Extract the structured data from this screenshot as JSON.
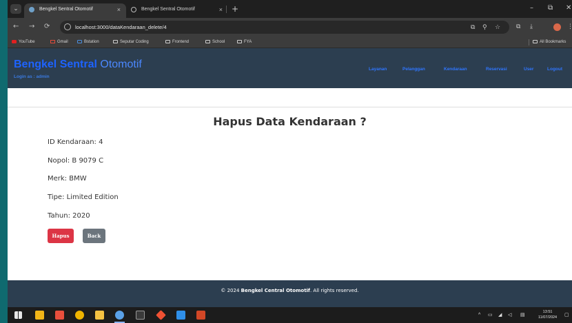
{
  "browser": {
    "tabs": [
      {
        "label": "Bengkel Sentral Otomotif",
        "active": true,
        "close_icon": "×"
      },
      {
        "label": "Bengkel Sentral Otomotif",
        "active": false,
        "close_icon": "×"
      }
    ],
    "new_tab_icon": "+",
    "tab_menu_icon": "⌄",
    "window_controls": {
      "minimize": "–",
      "maximize": "⧉",
      "close": "✕"
    },
    "nav": {
      "back": "←",
      "forward": "→",
      "reload": "⟳"
    },
    "url": "localhost:3000/dataKendaraan_delete/4",
    "omnibox_icons": {
      "install": "⧉",
      "zoom": "⚲",
      "star": "☆"
    },
    "toolbar_icons": {
      "extensions": "⧉",
      "downloads": "⤓",
      "menu": "⋮"
    },
    "bookmarks": [
      {
        "label": "YouTube",
        "icon": "youtube-icon"
      },
      {
        "label": "Gmail",
        "icon": "gmail-icon"
      },
      {
        "label": "Bstation",
        "icon": "bstation-icon"
      },
      {
        "label": "Seputar Coding",
        "icon": "folder-icon"
      },
      {
        "label": "Frontend",
        "icon": "folder-icon"
      },
      {
        "label": "School",
        "icon": "folder-icon"
      },
      {
        "label": "FYA",
        "icon": "folder-icon"
      }
    ],
    "all_bookmarks": "All Bookmarks"
  },
  "site": {
    "brand_bold": "Bengkel Sentral",
    "brand_light": "Otomotif",
    "login_prefix": "Login as : ",
    "login_user": "admin",
    "nav": [
      "Layanan",
      "Pelanggan",
      "Kendaraan",
      "Reservasi",
      "User",
      "Logout"
    ]
  },
  "main": {
    "title": "Hapus Data Kendaraan ?",
    "fields": [
      {
        "label": "ID Kendaraan:",
        "value": "4"
      },
      {
        "label": "Nopol:",
        "value": "B 9079 C"
      },
      {
        "label": "Merk:",
        "value": "BMW"
      },
      {
        "label": "Tipe:",
        "value": "Limited Edition"
      },
      {
        "label": "Tahun:",
        "value": "2020"
      }
    ],
    "delete_button": "Hapus",
    "back_button": "Back"
  },
  "footer": {
    "prefix": "© 2024 ",
    "brand": "Bengkel Central Otomotif",
    "suffix": ". All rights reserved."
  },
  "taskbar": {
    "apps": [
      "windows-start-icon",
      "file-explorer-icon",
      "app-icon",
      "chrome-icon",
      "files-icon",
      "chrome-active-icon",
      "terminal-icon",
      "git-icon",
      "vscode-icon",
      "powerpoint-icon"
    ],
    "tray_chevron": "^",
    "time": "13:51",
    "date": "11/07/2024"
  },
  "colors": {
    "header": "#2c3e50",
    "brand": "#1e63ff",
    "danger": "#dc3545",
    "secondary": "#6c757d"
  }
}
